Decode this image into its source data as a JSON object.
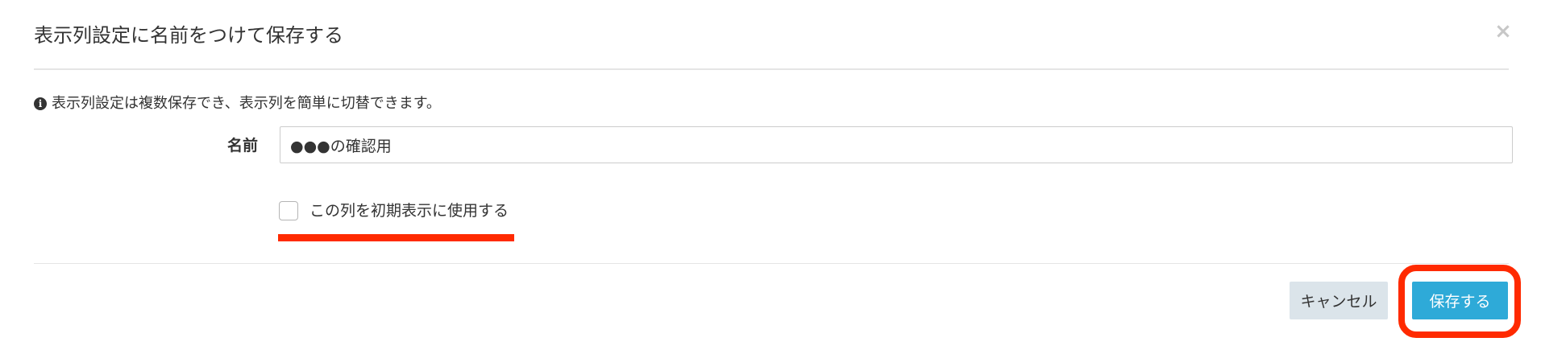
{
  "modal": {
    "title": "表示列設定に名前をつけて保存する",
    "close_glyph": "×"
  },
  "info": {
    "icon": "info-icon",
    "icon_glyph": "i",
    "text": "表示列設定は複数保存でき、表示列を簡単に切替できます。"
  },
  "form": {
    "name_label": "名前",
    "name_value": "●●●の確認用",
    "checkbox_label": "この列を初期表示に使用する",
    "checkbox_checked": false
  },
  "footer": {
    "cancel_label": "キャンセル",
    "save_label": "保存する"
  },
  "colors": {
    "primary": "#2eaad8",
    "secondary": "#dbe4ea",
    "annotation": "#ff2a00"
  }
}
